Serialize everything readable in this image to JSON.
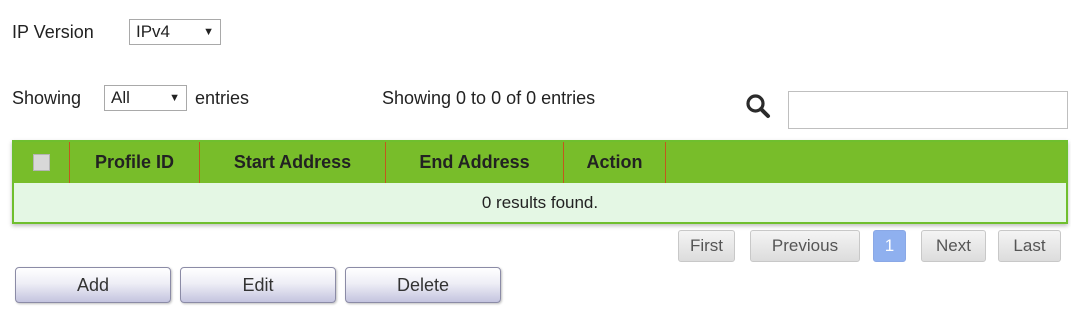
{
  "ip_version": {
    "label": "IP Version",
    "selected": "IPv4"
  },
  "showing": {
    "prefix": "Showing",
    "selected": "All",
    "suffix": "entries"
  },
  "summary": "Showing 0 to 0 of 0 entries",
  "search": {
    "icon": "search-icon",
    "value": ""
  },
  "table": {
    "columns": [
      "Profile ID",
      "Start Address",
      "End Address",
      "Action"
    ],
    "empty_message": "0 results found.",
    "header_color": "#78bd2a",
    "body_color": "#e4f7e4"
  },
  "pagination": {
    "first": "First",
    "previous": "Previous",
    "current": "1",
    "next": "Next",
    "last": "Last"
  },
  "actions": {
    "add": "Add",
    "edit": "Edit",
    "delete": "Delete"
  }
}
